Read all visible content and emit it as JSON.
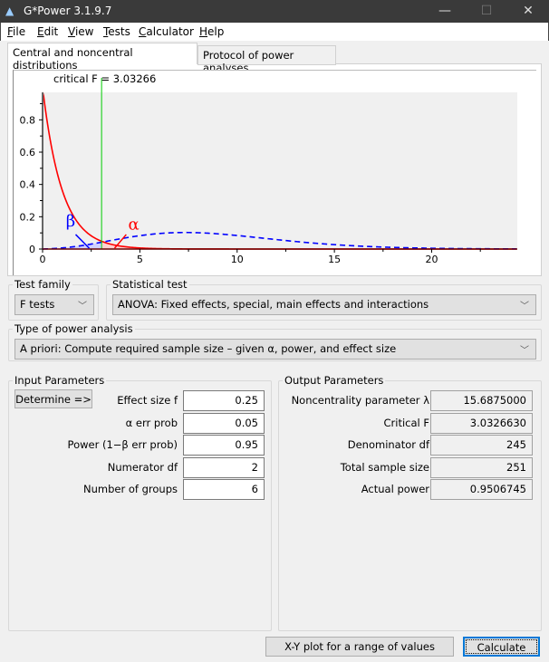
{
  "window": {
    "title": "G*Power 3.1.9.7",
    "minimize": "—",
    "maximize": "☐",
    "close": "✕",
    "icon": "gpower-logo-icon"
  },
  "menu": [
    {
      "label": "File",
      "u": "F",
      "rest": "ile"
    },
    {
      "label": "Edit",
      "u": "E",
      "rest": "dit"
    },
    {
      "label": "View",
      "u": "V",
      "rest": "iew"
    },
    {
      "label": "Tests",
      "u": "T",
      "rest": "ests"
    },
    {
      "label": "Calculator",
      "u": "C",
      "rest": "alculator"
    },
    {
      "label": "Help",
      "u": "H",
      "rest": "elp"
    }
  ],
  "tabs": [
    {
      "label": "Central and noncentral distributions",
      "active": true
    },
    {
      "label": "Protocol of power analyses",
      "active": false
    }
  ],
  "chart_data": {
    "type": "line",
    "annotation": "critical F = 3.03266",
    "critical_f": 3.03266,
    "xlim": [
      0,
      24.4
    ],
    "ylim": [
      0,
      0.97
    ],
    "xticks": [
      "0",
      "5",
      "10",
      "15",
      "20"
    ],
    "yticks": [
      "0",
      "0.2",
      "0.4",
      "0.6",
      "0.8"
    ],
    "df1": 2,
    "df2": 245,
    "lambda": 15.6875,
    "series": [
      {
        "label": "α",
        "distribution": "central F",
        "color": "#ff0000",
        "style": "solid"
      },
      {
        "label": "β",
        "distribution": "noncentral F",
        "color": "#0000ff",
        "style": "dashed"
      }
    ],
    "critical_line_color": "#00cc00",
    "plot_background": "#f0f0f0",
    "grid": false
  },
  "test_family": {
    "label": "Test family",
    "value": "F tests"
  },
  "statistical_test": {
    "label": "Statistical test",
    "value": "ANOVA: Fixed effects, special, main effects and interactions"
  },
  "power_analysis": {
    "label": "Type of power analysis",
    "value": "A priori: Compute required sample size – given α, power, and effect size"
  },
  "input": {
    "title": "Input Parameters",
    "determine": "Determine =>",
    "rows": [
      {
        "label": "Effect size f",
        "value": "0.25"
      },
      {
        "label": "α err prob",
        "value": "0.05"
      },
      {
        "label": "Power (1−β err prob)",
        "value": "0.95"
      },
      {
        "label": "Numerator df",
        "value": "2"
      },
      {
        "label": "Number of groups",
        "value": "6"
      }
    ]
  },
  "output": {
    "title": "Output Parameters",
    "rows": [
      {
        "label": "Noncentrality parameter λ",
        "value": "15.6875000"
      },
      {
        "label": "Critical F",
        "value": "3.0326630"
      },
      {
        "label": "Denominator df",
        "value": "245"
      },
      {
        "label": "Total sample size",
        "value": "251"
      },
      {
        "label": "Actual power",
        "value": "0.9506745"
      }
    ]
  },
  "buttons": {
    "xy_plot": "X-Y plot for a range of values",
    "calculate": "Calculate"
  }
}
